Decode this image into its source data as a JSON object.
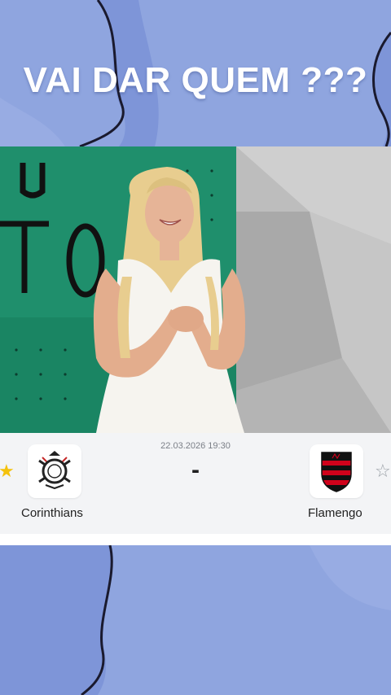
{
  "overlay": {
    "title": "VAI DAR QUEM ???"
  },
  "match": {
    "datetime": "22.03.2026 19:30",
    "score": "-",
    "home_team": {
      "name": "Corinthians",
      "favorite": true
    },
    "away_team": {
      "name": "Flamengo",
      "favorite": false
    }
  },
  "icons": {
    "home_star": "★",
    "away_star": "☆"
  },
  "colors": {
    "background": "#8fa5df",
    "star_active": "#f4c20d",
    "star_inactive": "#9aa0a6",
    "flamengo_red": "#d0021b"
  }
}
